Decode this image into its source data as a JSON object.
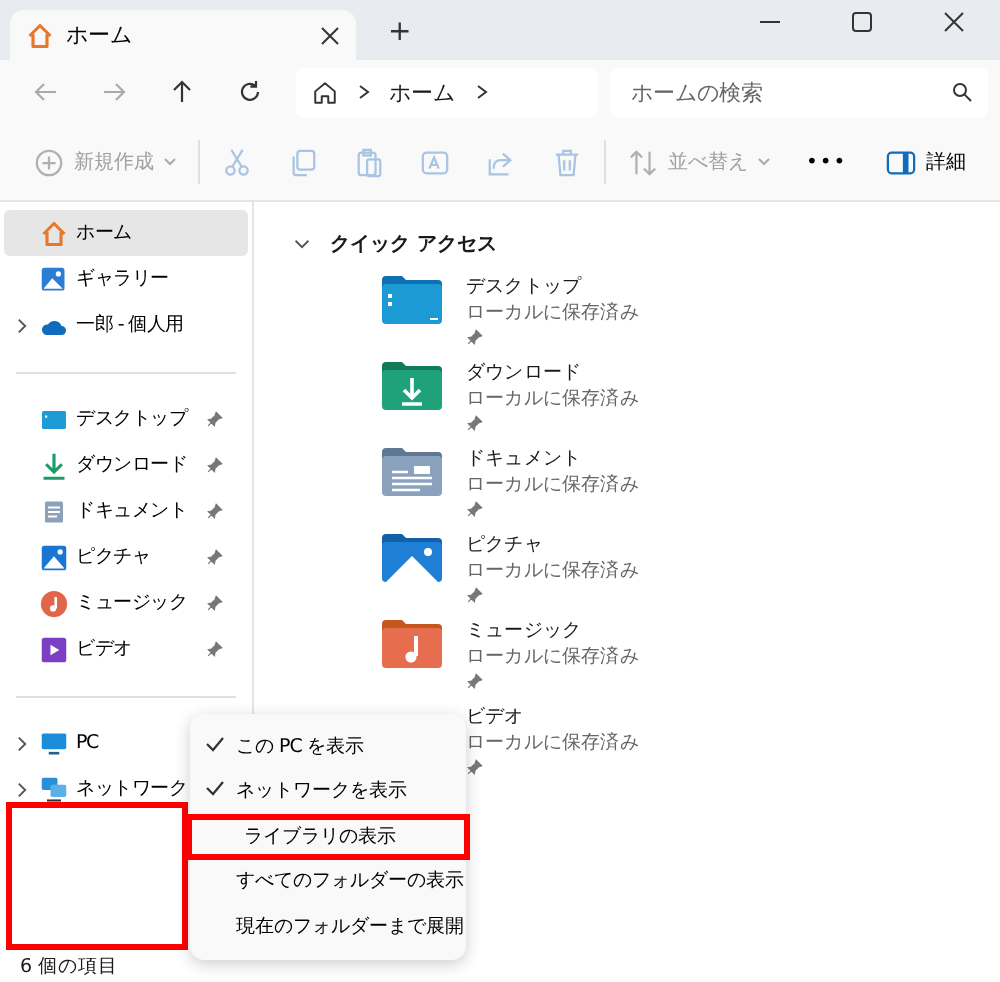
{
  "window": {
    "tab_title": "ホーム",
    "new_tab": "+"
  },
  "address_bar": {
    "crumbs": [
      "ホーム"
    ],
    "search": {
      "placeholder": "ホームの検索"
    }
  },
  "toolbar": [
    {
      "kind": "new",
      "label": "新規作成",
      "disabled": true
    },
    {
      "kind": "cut",
      "disabled": true
    },
    {
      "kind": "copy",
      "disabled": true
    },
    {
      "kind": "paste",
      "disabled": true
    },
    {
      "kind": "rename",
      "disabled": true
    },
    {
      "kind": "share",
      "disabled": true
    },
    {
      "kind": "delete",
      "disabled": true
    },
    {
      "kind": "sort",
      "label": "並べ替え",
      "disabled": true
    },
    {
      "kind": "more",
      "label": "•••",
      "disabled": false
    },
    {
      "kind": "details",
      "label": "詳細",
      "disabled": false
    }
  ],
  "sidebar": {
    "top": [
      {
        "kind": "home",
        "label": "ホーム",
        "selected": true
      },
      {
        "kind": "gallery",
        "label": "ギャラリー",
        "selected": false
      },
      {
        "kind": "cloud",
        "label": "一郎 - 個人用",
        "selected": false,
        "expanded": false
      }
    ],
    "pinned": [
      {
        "kind": "desktop",
        "label": "デスクトップ",
        "selected": false,
        "pinned": true
      },
      {
        "kind": "download",
        "label": "ダウンロード",
        "selected": false,
        "pinned": true
      },
      {
        "kind": "documents",
        "label": "ドキュメント",
        "selected": false,
        "pinned": true
      },
      {
        "kind": "pictures",
        "label": "ピクチャ",
        "selected": false,
        "pinned": true
      },
      {
        "kind": "music",
        "label": "ミュージック",
        "selected": false,
        "pinned": true
      },
      {
        "kind": "video",
        "label": "ビデオ",
        "selected": false,
        "pinned": true
      }
    ],
    "bottom": [
      {
        "kind": "pc",
        "label": "PC",
        "selected": false,
        "expanded": false
      },
      {
        "kind": "network",
        "label": "ネットワーク",
        "selected": false,
        "expanded": false
      }
    ],
    "empty_area_marked": true
  },
  "quick_access": {
    "title": "クイック アクセス",
    "expanded": true,
    "items": [
      {
        "kind": "desktop",
        "name": "デスクトップ",
        "status": "ローカルに保存済み",
        "pinned": true
      },
      {
        "kind": "download",
        "name": "ダウンロード",
        "status": "ローカルに保存済み",
        "pinned": true
      },
      {
        "kind": "documents",
        "name": "ドキュメント",
        "status": "ローカルに保存済み",
        "pinned": true
      },
      {
        "kind": "pictures",
        "name": "ピクチャ",
        "status": "ローカルに保存済み",
        "pinned": true
      },
      {
        "kind": "music",
        "name": "ミュージック",
        "status": "ローカルに保存済み",
        "pinned": true
      },
      {
        "kind": "hidden",
        "name": "ビデオ",
        "status": "ローカルに保存済み",
        "pinned": true
      }
    ]
  },
  "context_menu": [
    {
      "label": "この PC を表示",
      "checked": true,
      "highlighted": false
    },
    {
      "label": "ネットワークを表示",
      "checked": true,
      "highlighted": false
    },
    {
      "label": "ライブラリの表示",
      "checked": false,
      "highlighted": true
    },
    {
      "label": "すべてのフォルダーの表示",
      "checked": false,
      "highlighted": false
    },
    {
      "label": "現在のフォルダーまで展開",
      "checked": false,
      "highlighted": false
    }
  ],
  "status_bar": {
    "item_count": "6 個の項目"
  }
}
